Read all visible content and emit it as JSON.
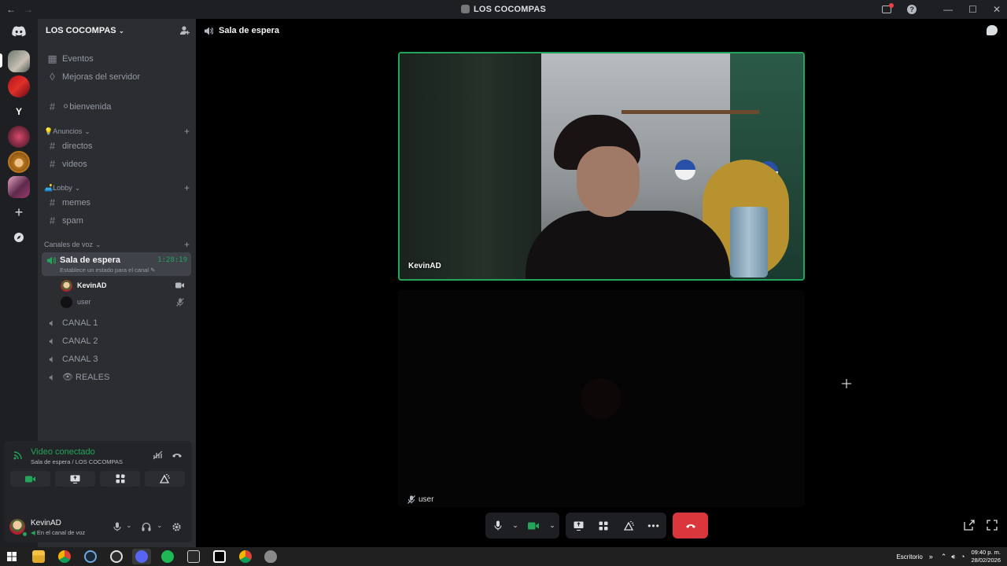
{
  "window": {
    "title": "LOS COCOMPAS"
  },
  "server": {
    "name": "LOS COCOMPAS"
  },
  "sidebar": {
    "top_items": [
      {
        "label": "Eventos"
      },
      {
        "label": "Mejoras del servidor"
      }
    ],
    "welcome_channel": "⚪bienvenida",
    "categories": {
      "anuncios": "💡Anuncios",
      "lobby": "🛋️Lobby",
      "voice": "Canales de voz"
    },
    "text_channels": {
      "directos": "directos",
      "videos": "videos",
      "memes": "memes",
      "spam": "spam"
    },
    "active_voice": {
      "name": "Sala de espera",
      "status": "Establece un estado para el canal",
      "timer": "1:28:19",
      "users": [
        {
          "name": "KevinAD"
        },
        {
          "name": "user"
        }
      ]
    },
    "voice_channels": [
      {
        "label": "CANAL 1"
      },
      {
        "label": "CANAL 2"
      },
      {
        "label": "CANAL 3"
      },
      {
        "label": "👁 REALES"
      }
    ]
  },
  "voice_panel": {
    "title": "Video conectado",
    "subtitle": "Sala de espera / LOS COCOMPAS"
  },
  "user_bar": {
    "username": "KevinAD",
    "status": "En el canal de voz"
  },
  "main": {
    "channel_title": "Sala de espera",
    "tiles": [
      {
        "name": "KevinAD"
      },
      {
        "name": "user"
      }
    ]
  },
  "taskbar": {
    "desktop_label": "Escritorio",
    "time": "09:40 p. m.",
    "date": "28/02/2026"
  },
  "colors": {
    "accent_green": "#23a55a",
    "hangup_red": "#da373c",
    "sidebar_bg": "#2b2d31",
    "rail_bg": "#1e1f22"
  }
}
